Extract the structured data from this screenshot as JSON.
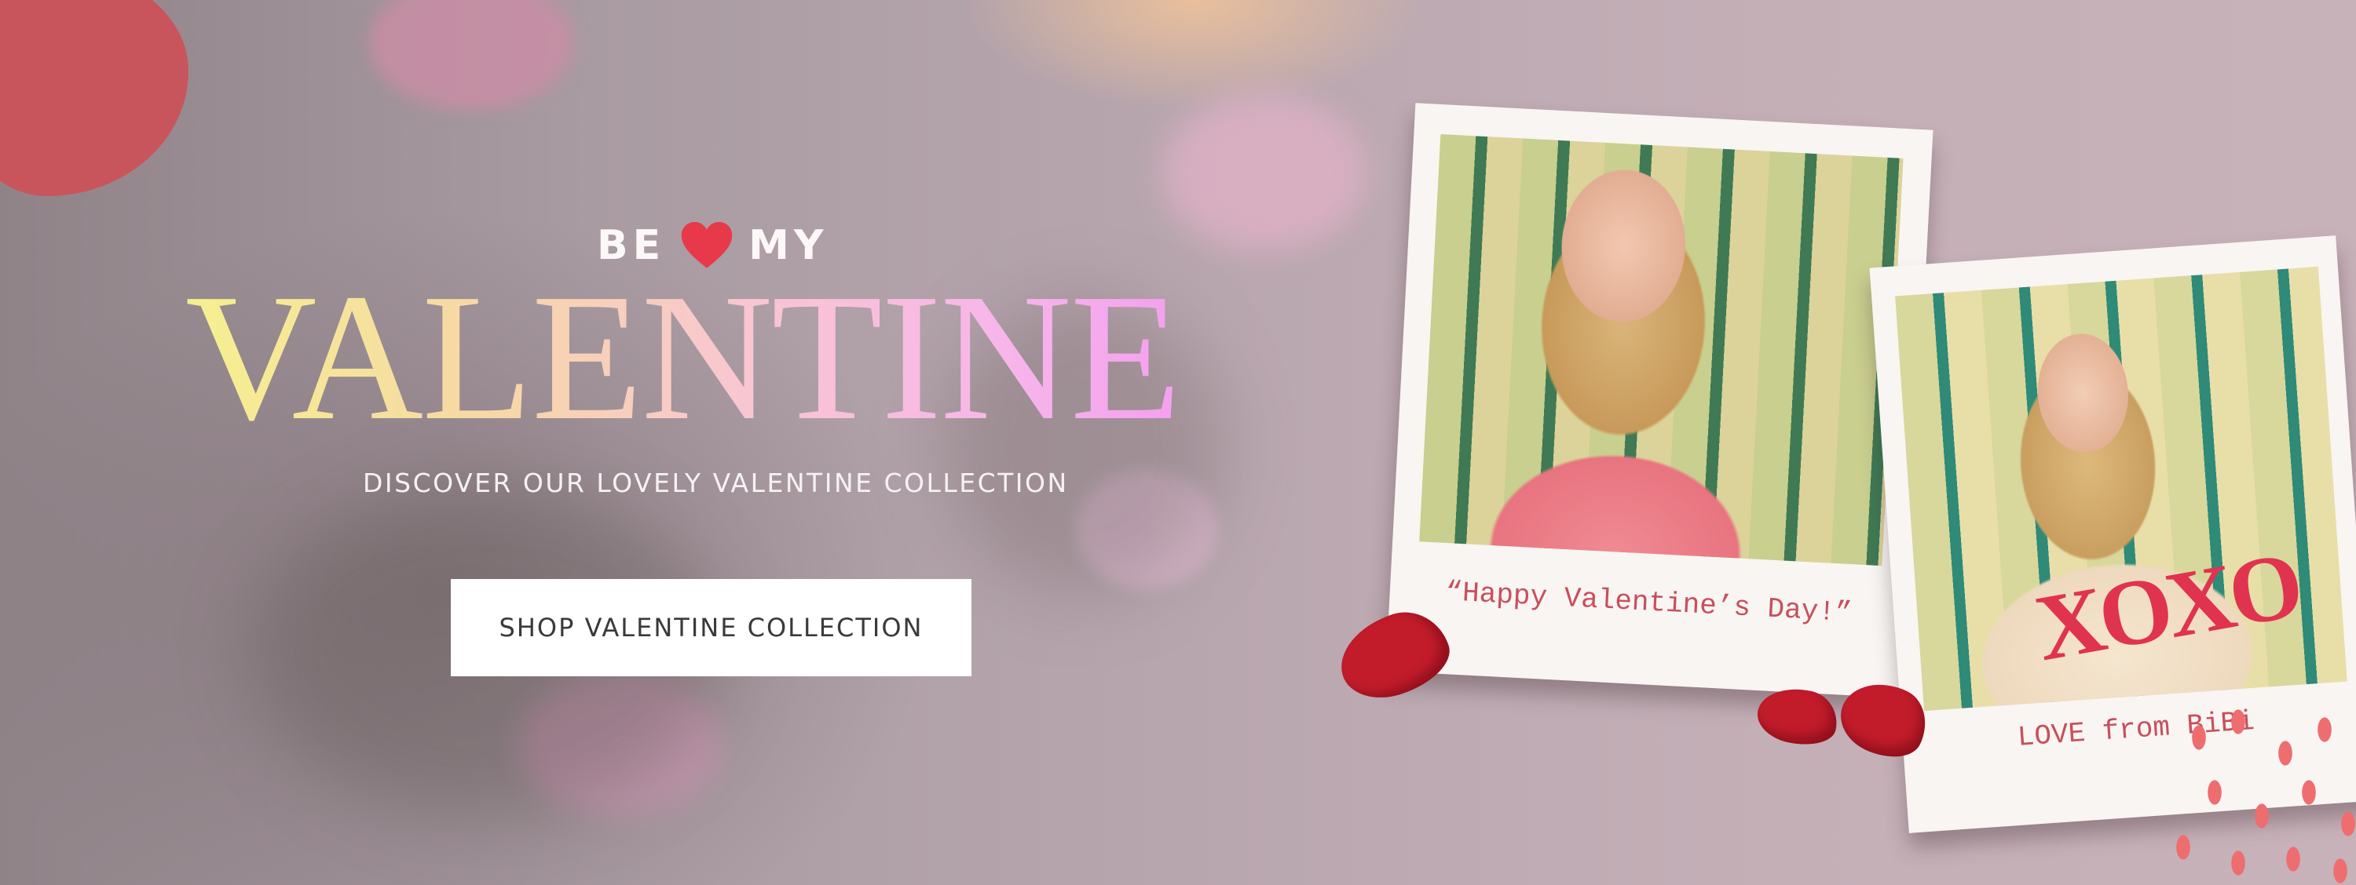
{
  "hero": {
    "eyebrow_left": "BE",
    "eyebrow_icon": "heart-icon",
    "eyebrow_right": "MY",
    "title": "VALENTINE",
    "subtitle": "DISCOVER OUR LOVELY VALENTINE COLLECTION",
    "cta_label": "SHOP VALENTINE COLLECTION"
  },
  "polaroids": [
    {
      "caption": "“Happy Valentine’s Day!”"
    },
    {
      "caption": "LOVE from BiBi",
      "sweater_text": "XOXO"
    }
  ],
  "colors": {
    "title_gradient": [
      "#f5f090",
      "#f7d9a4",
      "#f8c7cf",
      "#f7b6ea",
      "#f4a0ef"
    ],
    "heart": "#e8394a",
    "caption": "#c84f5c",
    "cta_background": "#ffffff",
    "cta_text": "#3a3a3a"
  }
}
